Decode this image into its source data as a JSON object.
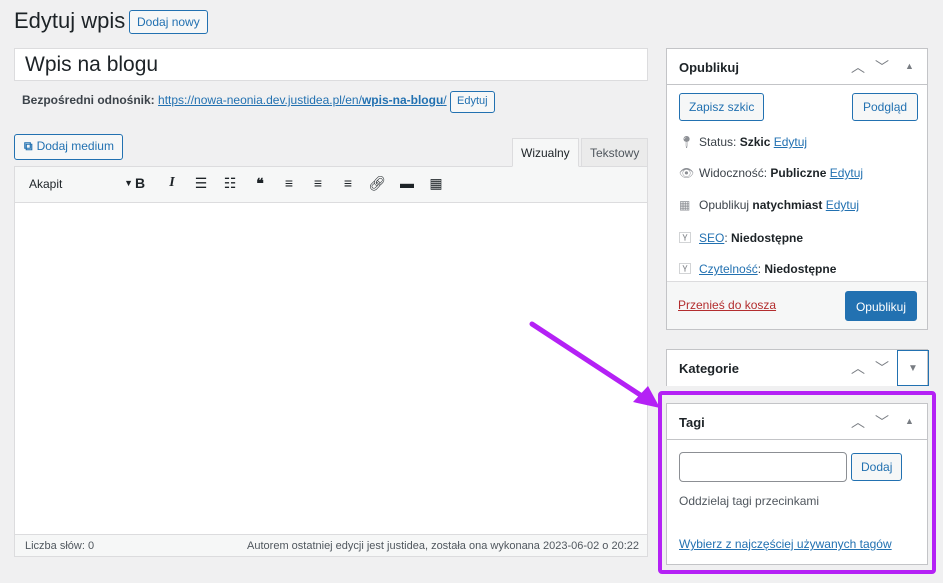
{
  "page": {
    "title": "Edytuj wpis",
    "add_new": "Dodaj nowy"
  },
  "post": {
    "title": "Wpis na blogu",
    "permalink_label": "Bezpośredni odnośnik:",
    "permalink_base": "https://nowa-neonia.dev.justidea.pl/en/",
    "permalink_slug": "wpis-na-blogu",
    "permalink_tail": "/",
    "permalink_edit": "Edytuj"
  },
  "editor": {
    "add_media": "Dodaj medium",
    "tab_visual": "Wizualny",
    "tab_text": "Tekstowy",
    "format": "Akapit",
    "toolbar": [
      "bold-icon",
      "italic-icon",
      "bulleted-list-icon",
      "numbered-list-icon",
      "blockquote-icon",
      "align-left-icon",
      "align-center-icon",
      "align-right-icon",
      "link-icon",
      "read-more-icon",
      "toolbar-toggle-icon"
    ],
    "word_count": "Liczba słów: 0",
    "last_edit": "Autorem ostatniej edycji jest justidea, została ona wykonana 2023-06-02 o 20:22"
  },
  "publish": {
    "title": "Opublikuj",
    "save_draft": "Zapisz szkic",
    "preview": "Podgląd",
    "status_label": "Status:",
    "status_value": "Szkic",
    "visibility_label": "Widoczność:",
    "visibility_value": "Publiczne",
    "schedule_label": "Opublikuj",
    "schedule_value": "natychmiast",
    "edit": "Edytuj",
    "seo_link": "SEO",
    "seo_value": "Niedostępne",
    "readability_link": "Czytelność",
    "readability_value": "Niedostępne",
    "trash": "Przenieś do kosza",
    "publish_button": "Opublikuj"
  },
  "categories": {
    "title": "Kategorie"
  },
  "tags": {
    "title": "Tagi",
    "add": "Dodaj",
    "hint": "Oddzielaj tagi przecinkami",
    "most_used": "Wybierz z najczęściej używanych tagów"
  },
  "annotation": {
    "highlight_color": "#b421f5"
  }
}
